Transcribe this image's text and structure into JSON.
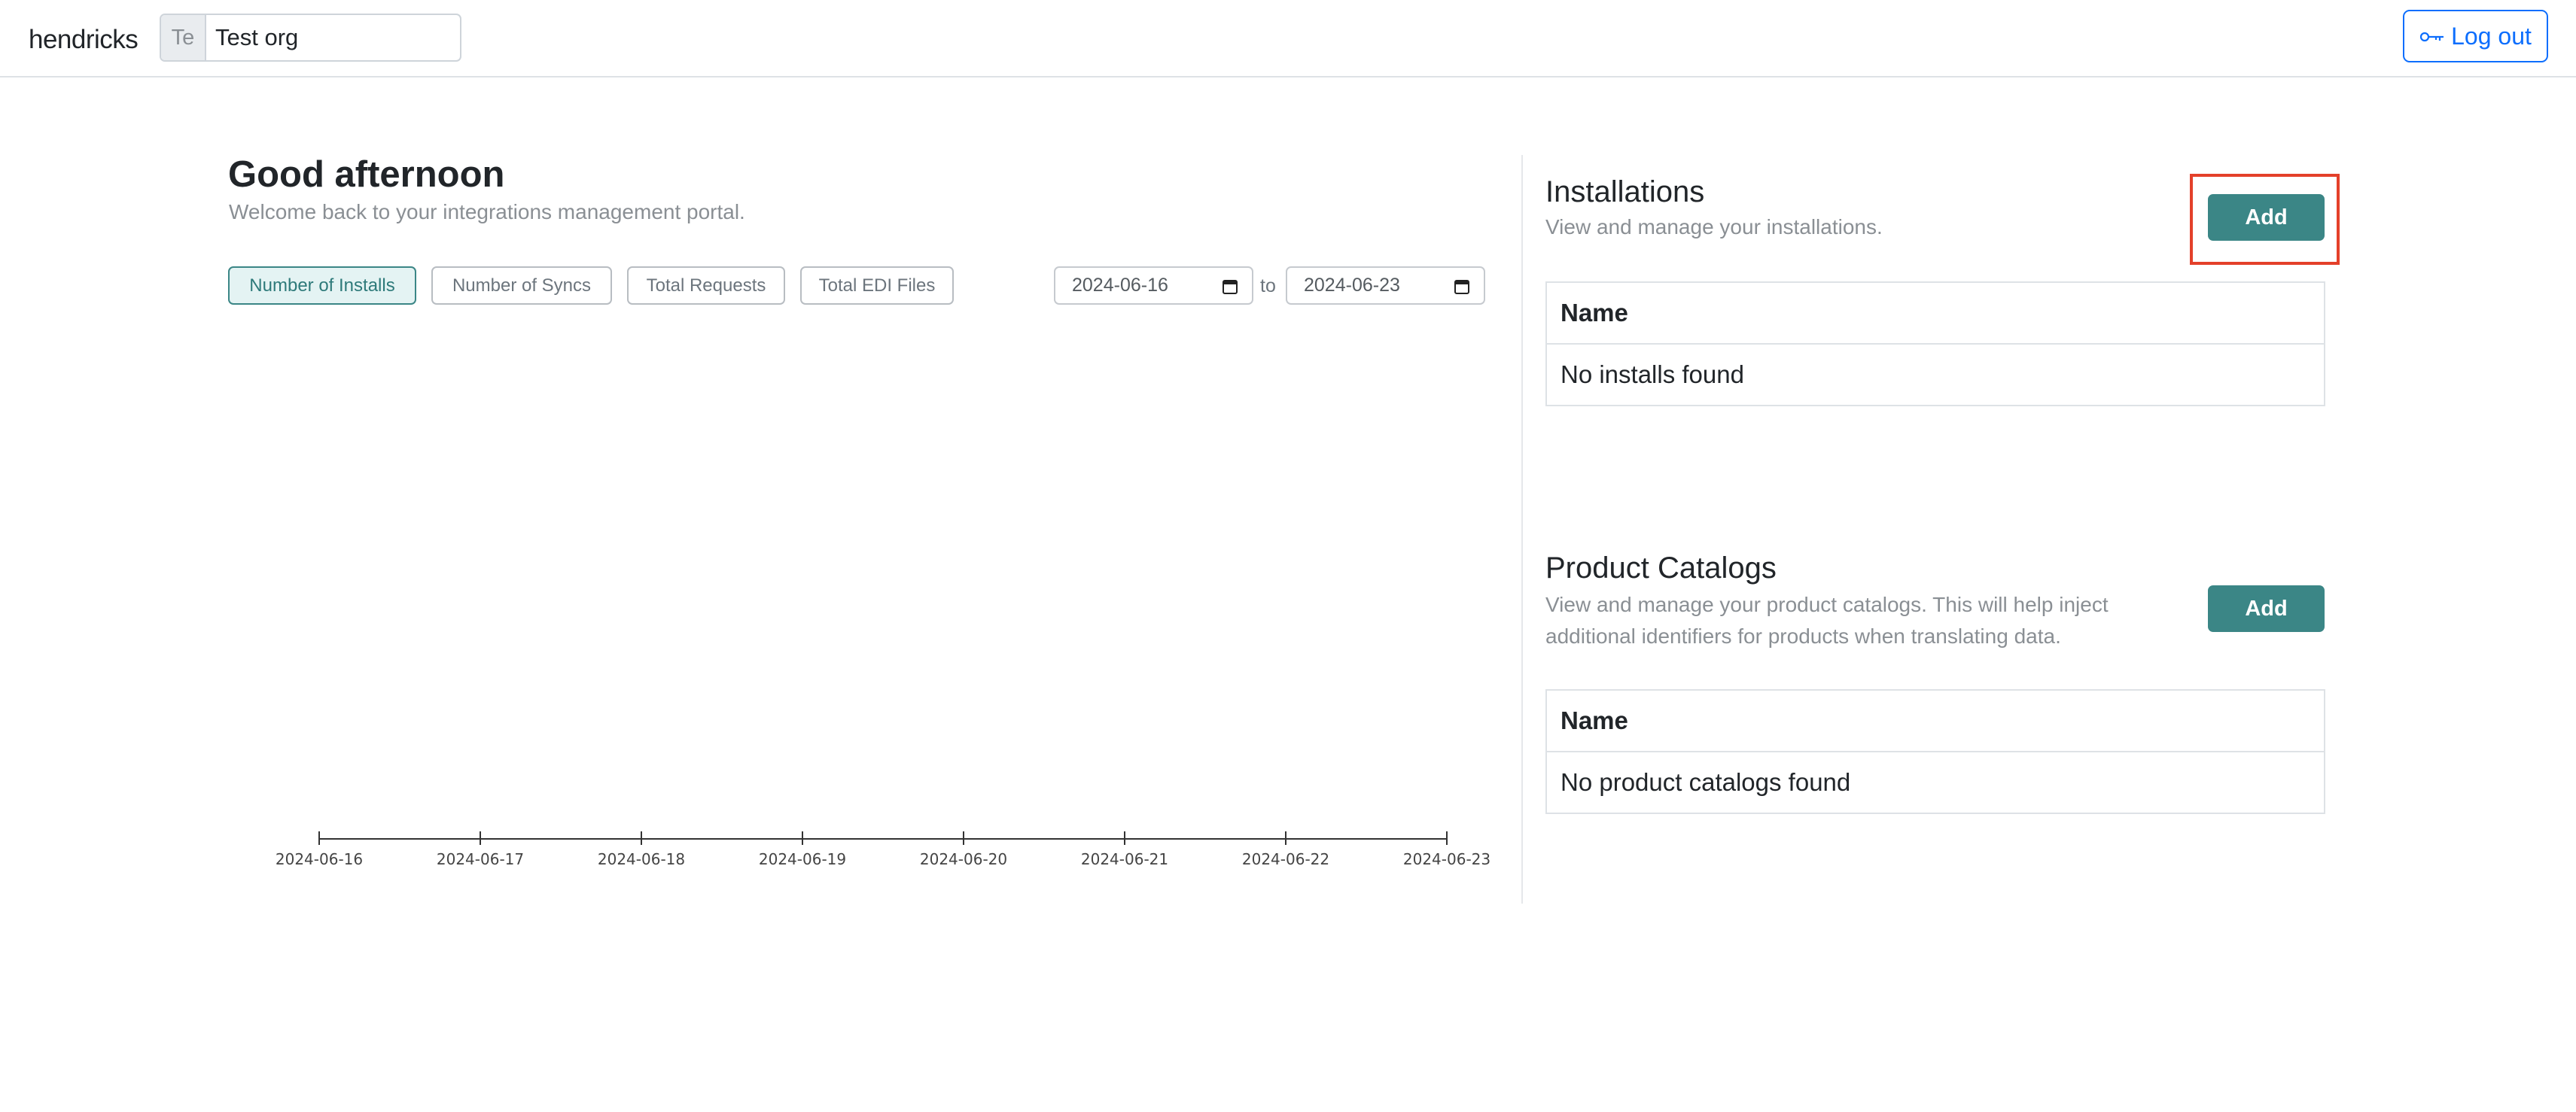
{
  "header": {
    "brand": "hendricks",
    "org": {
      "abbr": "Te",
      "name": "Test org"
    },
    "logout_label": "Log out",
    "logout_icon": "key-icon"
  },
  "main": {
    "greeting": "Good afternoon",
    "welcome": "Welcome back to your integrations management portal.",
    "metric_tabs": [
      {
        "label": "Number of Installs",
        "active": true
      },
      {
        "label": "Number of Syncs",
        "active": false
      },
      {
        "label": "Total Requests",
        "active": false
      },
      {
        "label": "Total EDI Files",
        "active": false
      }
    ],
    "date_range": {
      "from": "2024-06-16",
      "to_label": "to",
      "to": "2024-06-23"
    }
  },
  "chart_data": {
    "type": "line",
    "x": [
      "2024-06-16",
      "2024-06-17",
      "2024-06-18",
      "2024-06-19",
      "2024-06-20",
      "2024-06-21",
      "2024-06-22",
      "2024-06-23"
    ],
    "series": [],
    "title": "",
    "xlabel": "",
    "ylabel": ""
  },
  "installations": {
    "title": "Installations",
    "subtitle": "View and manage your installations.",
    "add_label": "Add",
    "column": "Name",
    "empty": "No installs found"
  },
  "catalogs": {
    "title": "Product Catalogs",
    "subtitle_line1": "View and manage your product catalogs. This will help inject",
    "subtitle_line2": "additional identifiers for products when translating data.",
    "add_label": "Add",
    "column": "Name",
    "empty": "No product catalogs found"
  },
  "colors": {
    "accent": "#3b8686",
    "link": "#0d6efd",
    "highlight": "#e4402a"
  }
}
